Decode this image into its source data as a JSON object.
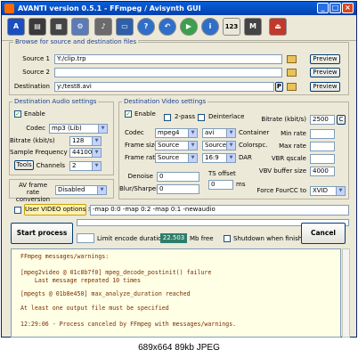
{
  "window": {
    "title": "AVANTI  version  0.5.1  -  FFmpeg / Avisynth GUI"
  },
  "toolbar": {
    "icons": [
      "avisynth-a-icon",
      "film-icon",
      "clapperboard-icon",
      "settings-icon",
      "mic-icon",
      "window-icon",
      "question-icon",
      "back-arrow-icon",
      "play-icon",
      "info-icon",
      "123-icon",
      "mpeg-icon",
      "exit-door-icon"
    ],
    "num_label": "123"
  },
  "browse": {
    "legend": "Browse for source and destination files",
    "source1_label": "Source 1",
    "source1_value": "Y:/clip.trp",
    "source2_label": "Source 2",
    "source2_value": "",
    "dest_label": "Destination",
    "dest_value": "y:/test8.avi",
    "p_label": "P",
    "preview_label": "Preview"
  },
  "audio": {
    "legend": "Destination Audio settings",
    "enable_label": "Enable",
    "codec_label": "Codec",
    "codec_value": "mp3 (Lib)",
    "bitrate_label": "Bitrate (kbit/s)",
    "bitrate_value": "128",
    "freq_label": "Sample Frequency",
    "freq_value": "44100",
    "tools_label": "Tools",
    "channels_label": "Channels",
    "channels_value": "2"
  },
  "avframe": {
    "label": "AV frame rate conversion",
    "value": "Disabled"
  },
  "video": {
    "legend": "Destination Video settings",
    "enable_label": "Enable",
    "twopass_label": "2-pass",
    "deinterlace_label": "Deinterlace",
    "codec_label": "Codec",
    "codec_value": "mpeg4",
    "container_value": "avi",
    "container_label": "Container",
    "framesize_label": "Frame size",
    "framesize_value": "Source",
    "colorspc_value": "Source",
    "colorspc_label": "Colorspc.",
    "framerate_label": "Frame rate",
    "framerate_value": "Source",
    "dar_value": "16:9",
    "dar_label": "DAR",
    "denoise_label": "Denoise",
    "denoise_value": "0",
    "blur_label": "Blur/Sharpen",
    "blur_value": "0",
    "ts_label": "TS offset",
    "ts_value": "0",
    "ts_unit": "ms",
    "bitrate_label": "Bitrate (kbit/s)",
    "bitrate_value": "2500",
    "c_label": "C",
    "minrate_label": "Min rate",
    "maxrate_label": "Max rate",
    "vbrq_label": "VBR qscale",
    "vbv_label": "VBV buffer size",
    "vbv_value": "4000",
    "fourcc_label": "Force FourCC to",
    "fourcc_value": "XVID"
  },
  "user_options": {
    "label": "User VIDEO options  >",
    "value": "-map 0:0 -map 0:2 -map 0:1 -newaudio"
  },
  "process": {
    "start_label": "Start process",
    "limit_label": "Limit encode duration",
    "mb_value": "22.503",
    "mb_label": "Mb free",
    "shutdown_label": "Shutdown when finished",
    "cancel_label": "Cancel"
  },
  "log_lines": [
    "FFmpeg messages/warnings:",
    "",
    "[mpeg2video @ 01c8b7f0] mpeg_decode_postinit() failure",
    "    Last message repeated 10 times",
    "",
    "[mpegts @ 01b8e450] max_analyze_duration reached",
    "",
    "At least one output file must be specified",
    "",
    "12:29:06 - Process canceled by FFmpeg with messages/warnings."
  ],
  "caption": "689x664  89kb  JPEG",
  "colors": {
    "title": "#0a5fd8",
    "legend": "#1b3f95",
    "log_bg": "#ffffe6",
    "mb_bg": "#2e7d6b"
  }
}
